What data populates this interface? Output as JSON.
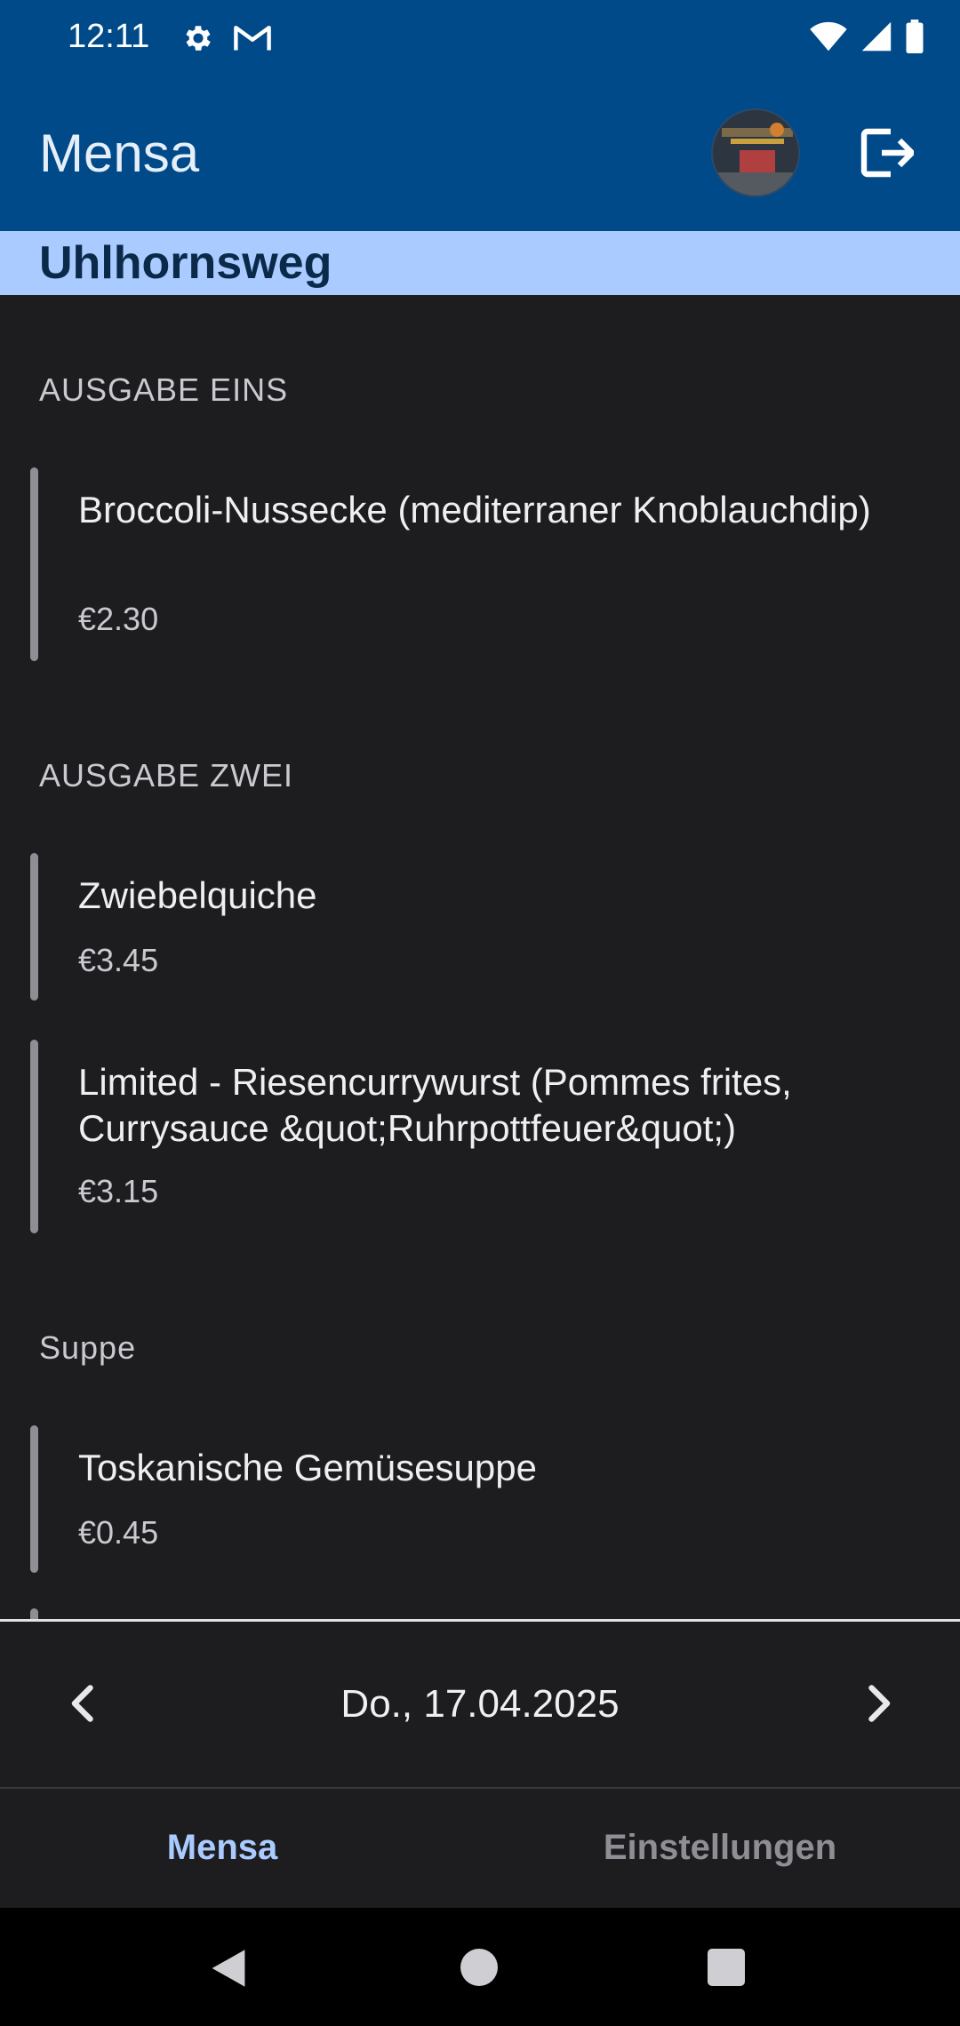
{
  "status": {
    "time": "12:11",
    "icons": [
      "gear-icon",
      "gmail-icon",
      "wifi-icon",
      "signal-icon",
      "battery-icon"
    ]
  },
  "appbar": {
    "title": "Mensa",
    "avatar": "user-avatar",
    "logout_icon": "logout-icon"
  },
  "location": {
    "name": "Uhlhornsweg"
  },
  "sections": [
    {
      "title": "AUSGABE EINS",
      "meals": [
        {
          "name": "Broccoli-Nussecke (mediterraner Knoblauchdip)",
          "price": "€2.30"
        }
      ]
    },
    {
      "title": "AUSGABE ZWEI",
      "meals": [
        {
          "name": "Zwiebelquiche",
          "price": "€3.45"
        },
        {
          "name": "Limited - Riesencurrywurst (Pommes frites, Currysauce &quot;Ruhrpottfeuer&quot;)",
          "price": "€3.15"
        }
      ]
    },
    {
      "title": "Suppe",
      "meals": [
        {
          "name": "Toskanische Gemüsesuppe",
          "price": "€0.45"
        }
      ]
    }
  ],
  "datebar": {
    "date": "Do., 17.04.2025",
    "prev_icon": "chevron-left-icon",
    "next_icon": "chevron-right-icon"
  },
  "bottomnav": {
    "tabs": [
      {
        "label": "Mensa",
        "active": true
      },
      {
        "label": "Einstellungen",
        "active": false
      }
    ]
  },
  "colors": {
    "primary": "#004a8a",
    "accent": "#a9cbff",
    "background": "#1d1d20"
  }
}
